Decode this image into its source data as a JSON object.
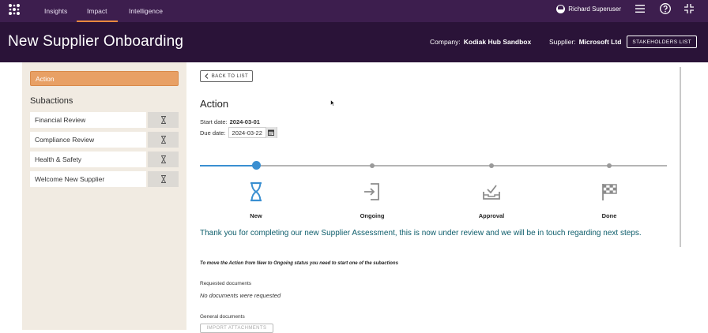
{
  "topbar": {
    "nav": [
      {
        "label": "Insights",
        "active": false
      },
      {
        "label": "Impact",
        "active": true
      },
      {
        "label": "Intelligence",
        "active": false
      }
    ],
    "user_name": "Richard Superuser",
    "icons": [
      "menu-icon",
      "help-icon",
      "collapse-icon"
    ]
  },
  "header": {
    "title": "New Supplier Onboarding",
    "company_label": "Company:",
    "company_value": "Kodiak Hub Sandbox",
    "supplier_label": "Supplier:",
    "supplier_value": "Microsoft Ltd",
    "stakeholders_button": "STAKEHOLDERS LIST"
  },
  "sidebar": {
    "action_label": "Action",
    "subactions_title": "Subactions",
    "subactions": [
      {
        "label": "Financial Review",
        "icon": "hourglass-icon"
      },
      {
        "label": "Compliance Review",
        "icon": "hourglass-icon"
      },
      {
        "label": "Health & Safety",
        "icon": "hourglass-icon"
      },
      {
        "label": "Welcome New Supplier",
        "icon": "hourglass-icon"
      }
    ]
  },
  "main": {
    "back_button": "BACK TO LIST",
    "title": "Action",
    "start_date_label": "Start date:",
    "start_date_value": "2024-03-01",
    "due_date_label": "Due date:",
    "due_date_value": "2024-03-22",
    "stages": [
      {
        "label": "New",
        "icon": "hourglass-icon",
        "active": true
      },
      {
        "label": "Ongoing",
        "icon": "enter-icon",
        "active": false
      },
      {
        "label": "Approval",
        "icon": "approval-tray-icon",
        "active": false
      },
      {
        "label": "Done",
        "icon": "checkered-flag-icon",
        "active": false
      }
    ],
    "message": "Thank you for completing our new Supplier Assessment, this is now under review and we will be in touch regarding next steps.",
    "instruction": "To move the Action from New to Ongoing status you need to start one of the subactions",
    "requested_docs_label": "Requested documents",
    "no_docs_text": "No documents were requested",
    "general_docs_label": "General documents",
    "import_button": "IMPORT ATTACHMENTS"
  },
  "colors": {
    "topbar": "#3d1e4e",
    "subheader": "#2a1338",
    "accent_orange": "#e8a065",
    "active_blue": "#3a8fd1",
    "message_teal": "#0d5d6b",
    "sidebar_bg": "#f1ebe2"
  }
}
